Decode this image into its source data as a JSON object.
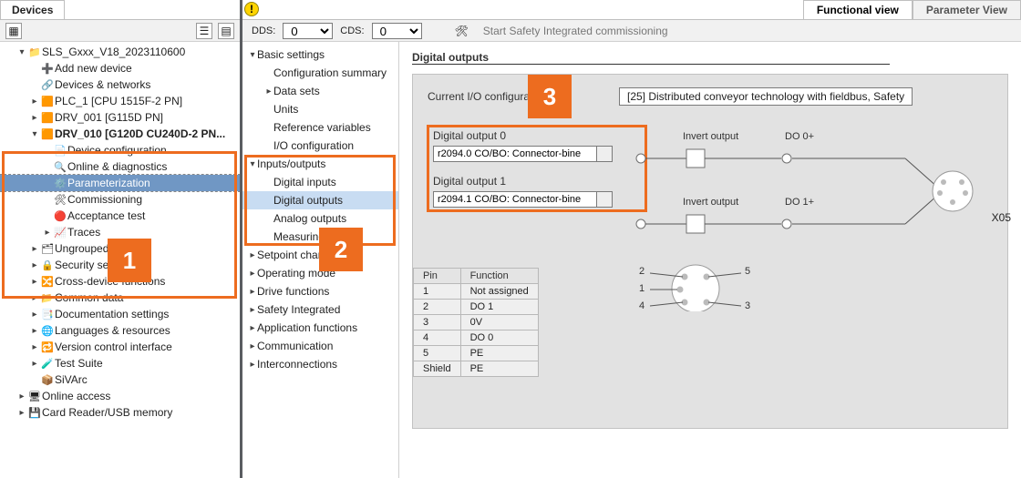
{
  "left_panel": {
    "tab": "Devices",
    "tree": [
      {
        "ind": 1,
        "tw": "▾",
        "ic": "📁",
        "label": "SLS_Gxxx_V18_2023110600"
      },
      {
        "ind": 2,
        "tw": "",
        "ic": "➕",
        "label": "Add new device"
      },
      {
        "ind": 2,
        "tw": "",
        "ic": "🔗",
        "label": "Devices & networks"
      },
      {
        "ind": 2,
        "tw": "",
        "ic": "🟧",
        "label": "PLC_1 [CPU 1515F-2 PN]",
        "chev": "▸"
      },
      {
        "ind": 2,
        "tw": "",
        "ic": "🟧",
        "label": "DRV_001 [G115D PN]",
        "chev": "▸",
        "hl": true
      },
      {
        "ind": 2,
        "tw": "▾",
        "ic": "🟧",
        "label": "DRV_010 [G120D CU240D-2 PN...",
        "hl": true,
        "bold": true
      },
      {
        "ind": 3,
        "tw": "",
        "ic": "📄",
        "label": "Device configuration",
        "hl": true
      },
      {
        "ind": 3,
        "tw": "",
        "ic": "🔍",
        "label": "Online & diagnostics",
        "hl": true
      },
      {
        "ind": 3,
        "tw": "",
        "ic": "⚙️",
        "label": "Parameterization",
        "hl": true,
        "sel": true,
        "dotted": true
      },
      {
        "ind": 3,
        "tw": "",
        "ic": "🛠",
        "label": "Commissioning",
        "hl": true
      },
      {
        "ind": 3,
        "tw": "",
        "ic": "🔴",
        "label": "Acceptance test",
        "hl": true
      },
      {
        "ind": 3,
        "tw": "",
        "ic": "📈",
        "label": "Traces",
        "chev": "▸",
        "hl": true
      },
      {
        "ind": 2,
        "tw": "",
        "ic": "🗂",
        "label": "Ungrouped devices",
        "chev": "▸",
        "hl": true
      },
      {
        "ind": 2,
        "tw": "",
        "ic": "🔒",
        "label": "Security settings",
        "chev": "▸"
      },
      {
        "ind": 2,
        "tw": "",
        "ic": "🔀",
        "label": "Cross-device functions",
        "chev": "▸"
      },
      {
        "ind": 2,
        "tw": "",
        "ic": "📂",
        "label": "Common data",
        "chev": "▸"
      },
      {
        "ind": 2,
        "tw": "",
        "ic": "📑",
        "label": "Documentation settings",
        "chev": "▸"
      },
      {
        "ind": 2,
        "tw": "",
        "ic": "🌐",
        "label": "Languages & resources",
        "chev": "▸"
      },
      {
        "ind": 2,
        "tw": "",
        "ic": "🔁",
        "label": "Version control interface",
        "chev": "▸"
      },
      {
        "ind": 2,
        "tw": "",
        "ic": "🧪",
        "label": "Test Suite",
        "chev": "▸"
      },
      {
        "ind": 2,
        "tw": "",
        "ic": "📦",
        "label": "SiVArc"
      },
      {
        "ind": 1,
        "tw": "",
        "ic": "🖥",
        "label": "Online access",
        "chev": "▸"
      },
      {
        "ind": 1,
        "tw": "",
        "ic": "💾",
        "label": "Card Reader/USB memory",
        "chev": "▸"
      }
    ]
  },
  "right_tabs": {
    "active": "Functional view",
    "other": "Parameter View"
  },
  "selectors": {
    "dds_label": "DDS:",
    "dds_value": "0",
    "cds_label": "CDS:",
    "cds_value": "0",
    "safety_text": "Start Safety Integrated commissioning"
  },
  "nav": [
    {
      "tw": "▾",
      "label": "Basic settings",
      "sub": [
        {
          "label": "Configuration summary"
        },
        {
          "tw": "▸",
          "label": "Data sets"
        },
        {
          "label": "Units"
        },
        {
          "label": "Reference variables"
        },
        {
          "label": "I/O configuration"
        }
      ]
    },
    {
      "tw": "▾",
      "label": "Inputs/outputs",
      "hl": true,
      "sub": [
        {
          "label": "Digital inputs",
          "hl": true
        },
        {
          "label": "Digital outputs",
          "hl": true,
          "sel": true
        },
        {
          "label": "Analog outputs",
          "hl": true
        },
        {
          "label": "Measuring probe",
          "hl": true
        }
      ]
    },
    {
      "tw": "▸",
      "label": "Setpoint channel"
    },
    {
      "tw": "▸",
      "label": "Operating mode"
    },
    {
      "tw": "▸",
      "label": "Drive functions"
    },
    {
      "tw": "▸",
      "label": "Safety Integrated"
    },
    {
      "tw": "▸",
      "label": "Application functions"
    },
    {
      "tw": "▸",
      "label": "Communication"
    },
    {
      "tw": "▸",
      "label": "Interconnections"
    }
  ],
  "content": {
    "title": "Digital outputs",
    "current_io_label": "Current I/O configuration",
    "current_io_value": "[25] Distributed conveyor technology with fieldbus, Safety",
    "do0": {
      "title": "Digital output 0",
      "value": "r2094.0 CO/BO: Connector-bine",
      "invert": "Invert output",
      "port": "DO 0+"
    },
    "do1": {
      "title": "Digital output 1",
      "value": "r2094.1 CO/BO: Connector-bine",
      "invert": "Invert output",
      "port": "DO 1+"
    },
    "x05": "X05",
    "table": {
      "head": [
        "Pin",
        "Function"
      ],
      "rows": [
        [
          "1",
          "Not assigned"
        ],
        [
          "2",
          "DO 1"
        ],
        [
          "3",
          "0V"
        ],
        [
          "4",
          "DO 0"
        ],
        [
          "5",
          "PE"
        ],
        [
          "Shield",
          "PE"
        ]
      ]
    },
    "pin_labels": {
      "tl": "2",
      "tr": "5",
      "ml": "1",
      "bl": "4",
      "br": "3"
    }
  },
  "callouts": {
    "1": "1",
    "2": "2",
    "3": "3"
  }
}
